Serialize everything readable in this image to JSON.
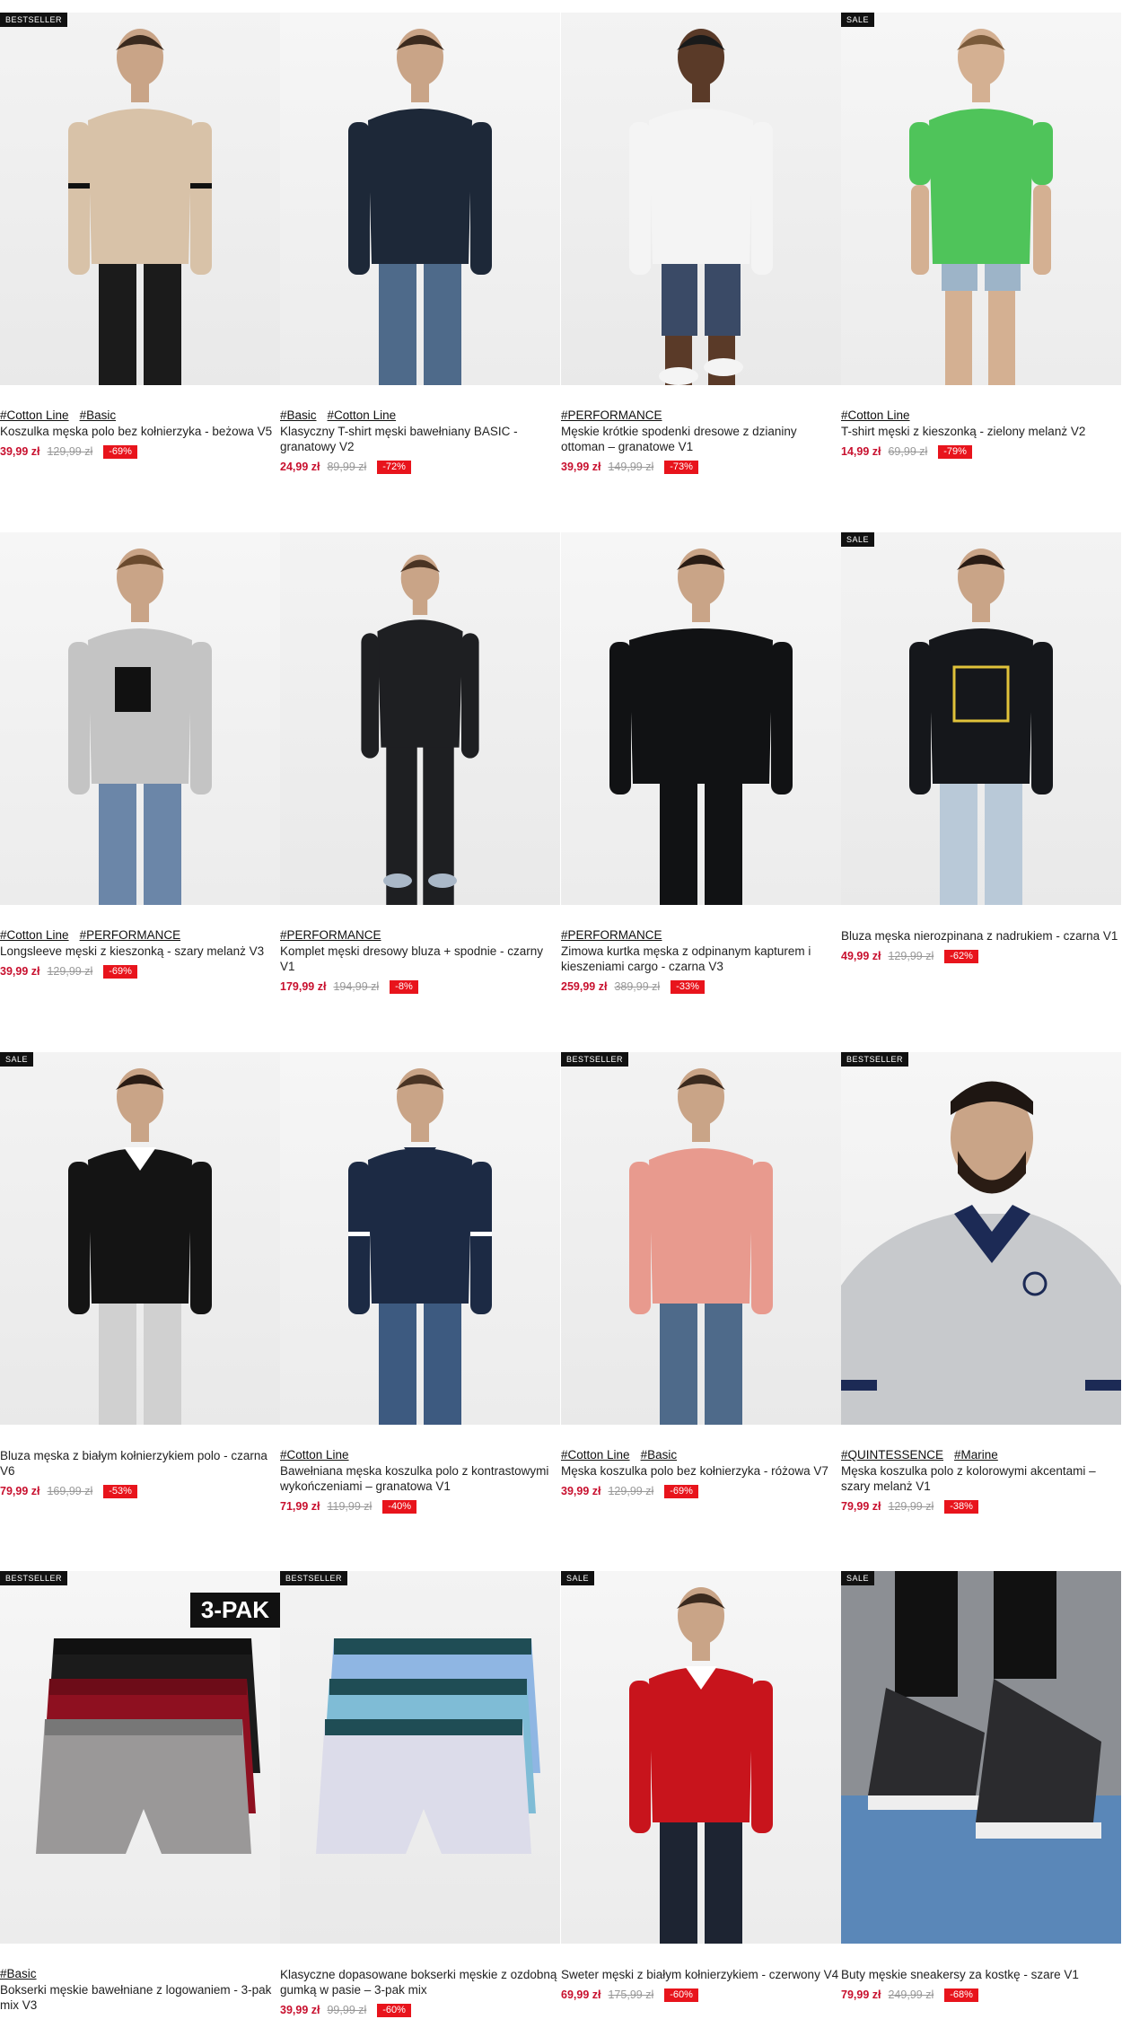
{
  "colors": {
    "price": "#c8102e",
    "discount_bg": "#e8141c",
    "badge_bg": "#111111"
  },
  "products": [
    {
      "badge": "BESTSELLER",
      "tags": [
        "#Cotton Line",
        "#Basic"
      ],
      "name": "Koszulka męska polo bez kołnierzyka - beżowa V5",
      "price": "39,99 zł",
      "old": "129,99 zł",
      "discount": "-69%",
      "icon": "beige-henley-figure"
    },
    {
      "badge": "",
      "tags": [
        "#Basic",
        "#Cotton Line"
      ],
      "name": "Klasyczny T-shirt męski bawełniany BASIC - granatowy V2",
      "price": "24,99 zł",
      "old": "89,99 zł",
      "discount": "-72%",
      "icon": "navy-tshirt-figure"
    },
    {
      "badge": "",
      "tags": [
        "#PERFORMANCE"
      ],
      "name": "Męskie krótkie spodenki dresowe z dzianiny ottoman – granatowe V1",
      "price": "39,99 zł",
      "old": "149,99 zł",
      "discount": "-73%",
      "icon": "navy-shorts-figure"
    },
    {
      "badge": "SALE",
      "tags": [
        "#Cotton Line"
      ],
      "name": "T-shirt męski z kieszonką - zielony melanż V2",
      "price": "14,99 zł",
      "old": "69,99 zł",
      "discount": "-79%",
      "icon": "green-tshirt-figure"
    },
    {
      "badge": "",
      "tags": [
        "#Cotton Line",
        "#PERFORMANCE"
      ],
      "name": "Longsleeve męski z kieszonką - szary melanż V3",
      "price": "39,99 zł",
      "old": "129,99 zł",
      "discount": "-69%",
      "icon": "grey-longsleeve-figure"
    },
    {
      "badge": "",
      "tags": [
        "#PERFORMANCE"
      ],
      "name": "Komplet męski dresowy bluza + spodnie - czarny V1",
      "price": "179,99 zł",
      "old": "194,99 zł",
      "discount": "-8%",
      "icon": "black-tracksuit-figure"
    },
    {
      "badge": "",
      "tags": [
        "#PERFORMANCE"
      ],
      "name": "Zimowa kurtka męska z odpinanym kapturem i kieszeniami cargo - czarna V3",
      "price": "259,99 zł",
      "old": "389,99 zł",
      "discount": "-33%",
      "icon": "black-jacket-figure"
    },
    {
      "badge": "SALE",
      "tags": [],
      "name": "Bluza męska nierozpinana z nadrukiem - czarna V1",
      "price": "49,99 zł",
      "old": "129,99 zł",
      "discount": "-62%",
      "icon": "black-sweatshirt-figure"
    },
    {
      "badge": "SALE",
      "tags": [],
      "name": "Bluza męska z białym kołnierzykiem polo - czarna V6",
      "price": "79,99 zł",
      "old": "169,99 zł",
      "discount": "-53%",
      "icon": "black-polo-sweatshirt-figure"
    },
    {
      "badge": "",
      "tags": [
        "#Cotton Line"
      ],
      "name": "Bawełniana męska koszulka polo z kontrastowymi wykończeniami – granatowa V1",
      "price": "71,99 zł",
      "old": "119,99 zł",
      "discount": "-40%",
      "icon": "navy-polo-figure"
    },
    {
      "badge": "BESTSELLER",
      "tags": [
        "#Cotton Line",
        "#Basic"
      ],
      "name": "Męska koszulka polo bez kołnierzyka - różowa V7",
      "price": "39,99 zł",
      "old": "129,99 zł",
      "discount": "-69%",
      "icon": "pink-henley-figure"
    },
    {
      "badge": "BESTSELLER",
      "tags": [
        "#QUINTESSENCE",
        "#Marine"
      ],
      "name": "Męska koszulka polo z kolorowymi akcentami – szary melanż V1",
      "price": "79,99 zł",
      "old": "129,99 zł",
      "discount": "-38%",
      "icon": "grey-polo-figure"
    },
    {
      "badge": "BESTSELLER",
      "tags": [
        "#Basic"
      ],
      "name": "Bokserki męskie bawełniane z logowaniem - 3-pak mix V3",
      "price": "",
      "old": "",
      "discount": "",
      "pak": "3-PAK",
      "icon": "boxers-3pack"
    },
    {
      "badge": "BESTSELLER",
      "tags": [],
      "name": "Klasyczne dopasowane bokserki męskie z ozdobną gumką w pasie – 3-pak mix",
      "price": "39,99 zł",
      "old": "99,99 zł",
      "discount": "-60%",
      "icon": "boxers-blue-3pack"
    },
    {
      "badge": "SALE",
      "tags": [],
      "name": "Sweter męski z białym kołnierzykiem - czerwony V4",
      "price": "69,99 zł",
      "old": "175,99 zł",
      "discount": "-60%",
      "icon": "red-sweater-figure"
    },
    {
      "badge": "SALE",
      "tags": [],
      "name": "Buty męskie sneakersy za kostkę - szare V1",
      "price": "79,99 zł",
      "old": "249,99 zł",
      "discount": "-68%",
      "icon": "grey-sneakers"
    }
  ]
}
